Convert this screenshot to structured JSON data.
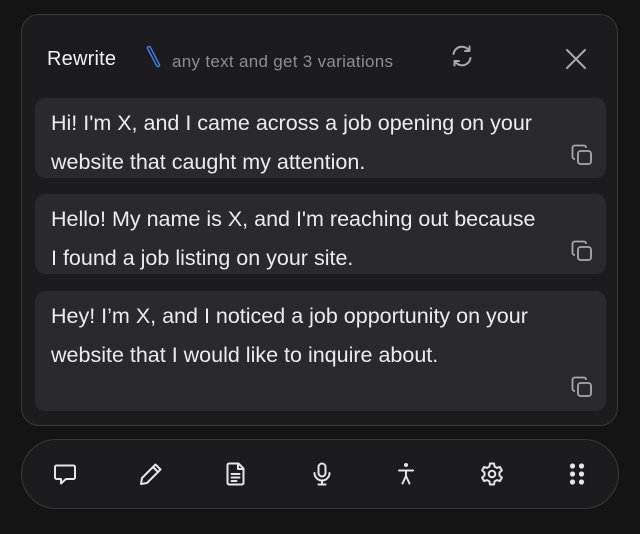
{
  "header": {
    "title": "Rewrite",
    "subtitle": "any text and get 3 variations",
    "icons": {
      "wand": "magic-wand-icon",
      "refresh": "refresh-icon",
      "close": "close-icon"
    }
  },
  "variations": [
    {
      "text": "Hi! I'm X, and I came across a job opening on your website that caught my attention.",
      "copy_icon": "copy-icon"
    },
    {
      "text": "Hello! My name is X, and I'm reaching out because I found a job listing on your site.",
      "copy_icon": "copy-icon"
    },
    {
      "text": "Hey! I’m X, and I noticed a job opportunity on your website that I would like to inquire about.",
      "copy_icon": "copy-icon"
    }
  ],
  "toolbar": {
    "tools": [
      "chat-icon",
      "pencil-icon",
      "document-icon",
      "microphone-icon",
      "accessibility-icon",
      "gear-icon",
      "grid-dots-icon"
    ]
  },
  "colors": {
    "background": "#141414",
    "panel": "#1c1c1e",
    "card": "#2a2a2c",
    "border": "#3a3a3c",
    "text": "#ececec",
    "muted": "#8e8e93",
    "accent": "#3b82f6"
  }
}
